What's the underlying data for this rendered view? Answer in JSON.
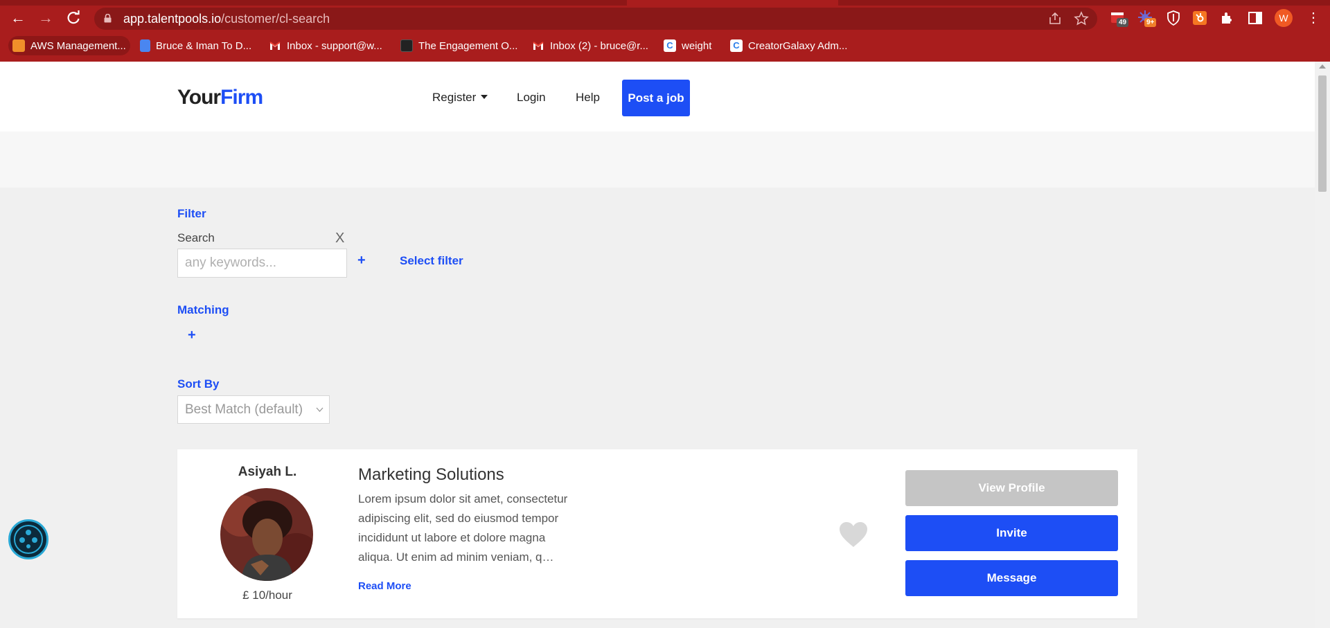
{
  "browser": {
    "url_host": "app.talentpools.io",
    "url_path": "/customer/cl-search",
    "extension_badges": [
      "49",
      "9+"
    ],
    "profile_initial": "W",
    "bookmarks": [
      {
        "label": "AWS Management...",
        "icon": "aws-icon"
      },
      {
        "label": "Bruce & Iman To D...",
        "icon": "docs-icon"
      },
      {
        "label": "Inbox - support@w...",
        "icon": "gmail-icon"
      },
      {
        "label": "The Engagement O...",
        "icon": "bookmark-icon"
      },
      {
        "label": "Inbox (2) - bruce@r...",
        "icon": "gmail-icon"
      },
      {
        "label": "weight",
        "icon": "creatorgalaxy-icon"
      },
      {
        "label": "CreatorGalaxy Adm...",
        "icon": "creatorgalaxy-icon"
      }
    ]
  },
  "header": {
    "logo_part1": "Your",
    "logo_part2": "Firm",
    "nav": {
      "register": "Register",
      "login": "Login",
      "help": "Help"
    },
    "post_job": "Post a job"
  },
  "filter": {
    "heading": "Filter",
    "search_label": "Search",
    "clear": "X",
    "search_placeholder": "any keywords...",
    "search_value": "",
    "add": "+",
    "select_filter": "Select filter"
  },
  "matching": {
    "heading": "Matching",
    "add": "+"
  },
  "sort": {
    "heading": "Sort By",
    "selected": "Best Match (default)"
  },
  "results": [
    {
      "name": "Asiyah L.",
      "rate": "£ 10/hour",
      "title": "Marketing Solutions",
      "description": "Lorem ipsum dolor sit amet, consectetur adipiscing elit, sed do eiusmod tempor incididunt ut labore et dolore magna aliqua. Ut enim ad minim veniam, q…",
      "read_more": "Read More",
      "view_profile": "View Profile",
      "invite": "Invite",
      "message": "Message"
    }
  ],
  "colors": {
    "accent": "#1d4ef5",
    "chrome": "#a91d1d",
    "disabled": "#c5c5c5"
  }
}
